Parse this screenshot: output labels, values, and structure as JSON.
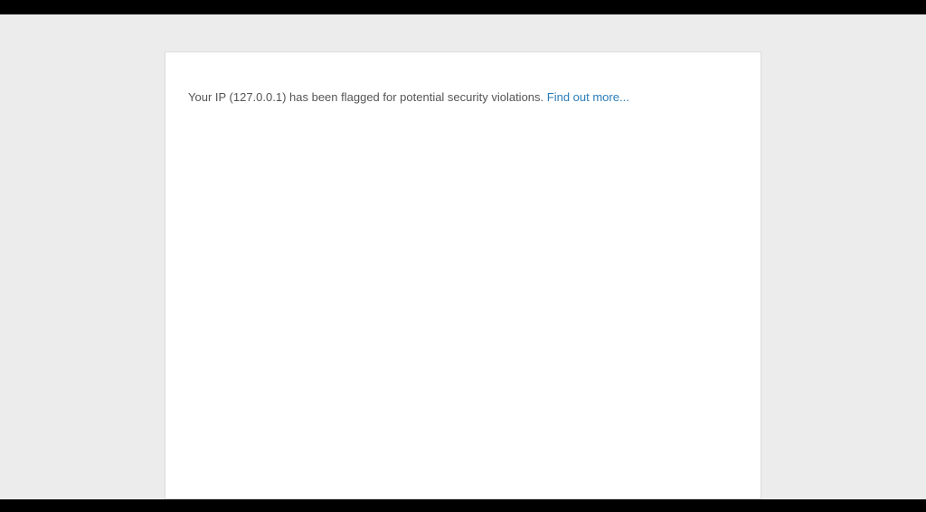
{
  "message": {
    "text": "Your IP (127.0.0.1) has been flagged for potential security violations. ",
    "link_label": "Find out more..."
  }
}
